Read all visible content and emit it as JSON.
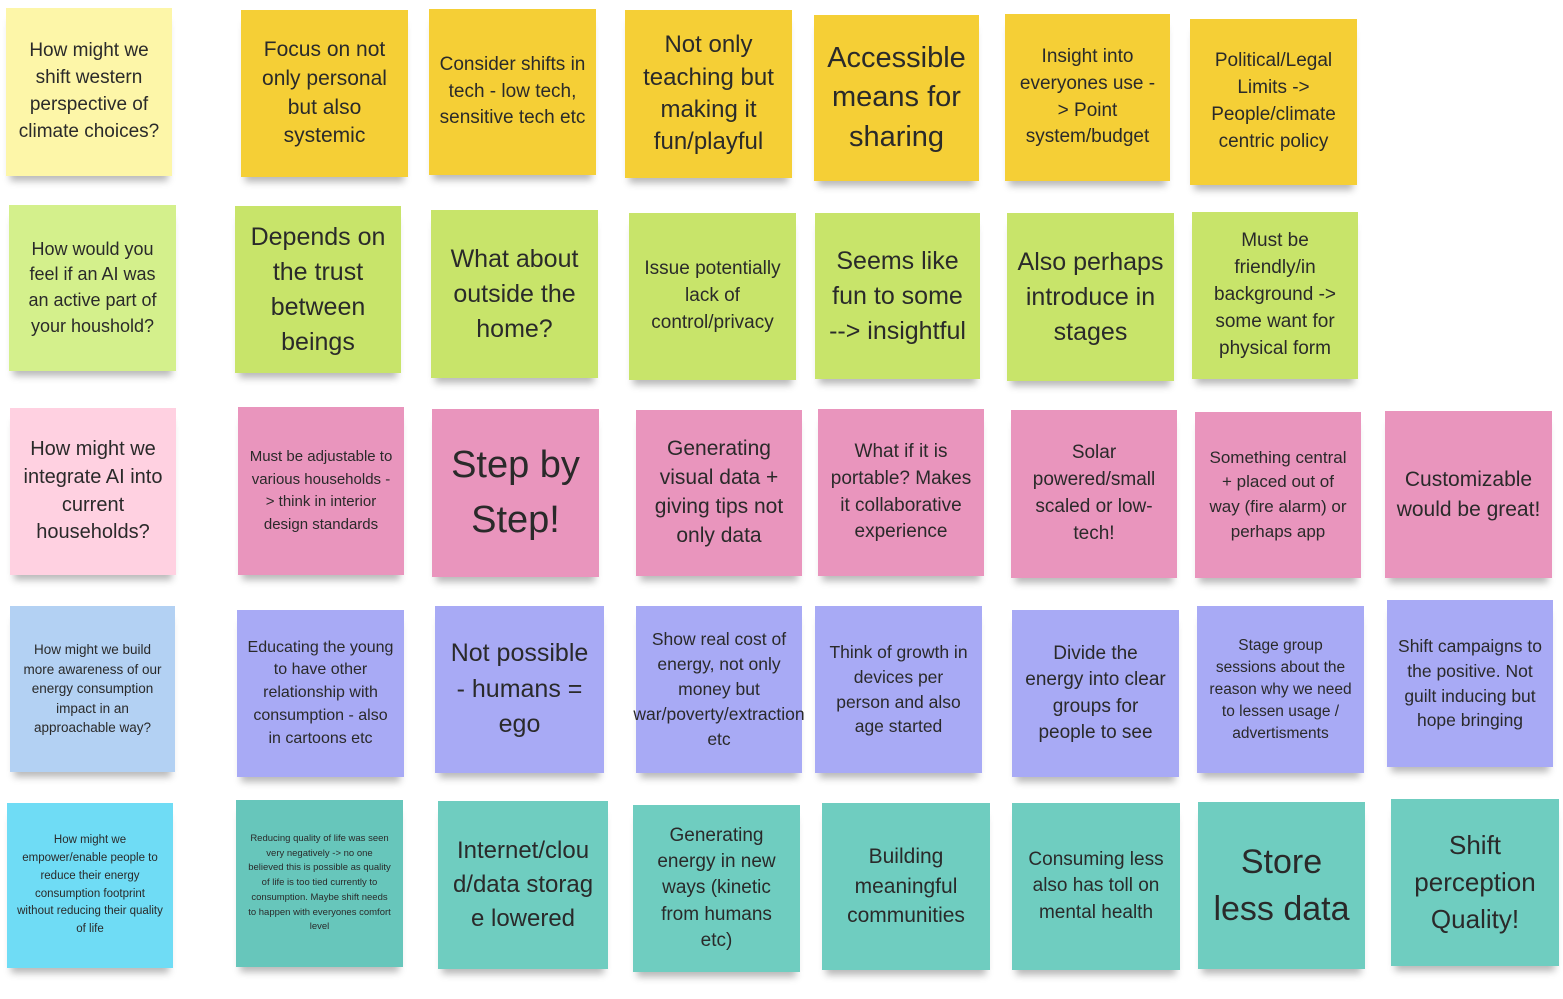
{
  "board": {
    "colors": {
      "pale_yellow": "#fdf6a8",
      "yellow": "#f5cf36",
      "lime": "#c8e46a",
      "pale_lime": "#d4f08c",
      "pink": "#e995bd",
      "pale_pink": "#ffd1e1",
      "violet": "#a8aaf5",
      "pale_blue": "#b3d1f3",
      "teal": "#6fcdc0",
      "cyan": "#6fdcf5",
      "dark_teal": "#67c6bb"
    },
    "rows": [
      {
        "notes": [
          {
            "text": "How might we shift western perspective of climate choices?"
          },
          {
            "text": "Focus on not only personal but also systemic"
          },
          {
            "text": "Consider shifts in tech - low tech, sensitive tech etc"
          },
          {
            "text": "Not only teaching but making it fun/playful"
          },
          {
            "text": "Accessible means for sharing"
          },
          {
            "text": "Insight into everyones use -> Point system/budget"
          },
          {
            "text": "Political/Legal Limits -> People/climate centric policy"
          }
        ]
      },
      {
        "notes": [
          {
            "text": "How would you feel if an AI was an active part of your houshold?"
          },
          {
            "text": "Depends on the trust between beings"
          },
          {
            "text": "What about outside the home?"
          },
          {
            "text": "Issue potentially lack of control/privacy"
          },
          {
            "text": "Seems like fun to some --> insightful"
          },
          {
            "text": "Also perhaps introduce in stages"
          },
          {
            "text": "Must be friendly/in background -> some want for physical form"
          }
        ]
      },
      {
        "notes": [
          {
            "text": "How might we integrate AI into current households?"
          },
          {
            "text": "Must be adjustable to various households -> think in interior design standards"
          },
          {
            "text": "Step by Step!"
          },
          {
            "text": "Generating visual data + giving tips not only data"
          },
          {
            "text": "What if it is portable? Makes it collaborative experience"
          },
          {
            "text": "Solar powered/small scaled or low-tech!"
          },
          {
            "text": "Something central + placed out of way (fire alarm) or perhaps app"
          },
          {
            "text": "Customizable would be great!"
          }
        ]
      },
      {
        "notes": [
          {
            "text": "How might we build more awareness of our energy consumption impact in an approachable way?"
          },
          {
            "text": "Educating the young to have other relationship with consumption - also in cartoons etc"
          },
          {
            "text": "Not possible - humans = ego"
          },
          {
            "text": "Show real cost of energy, not only money but war/poverty/extraction etc"
          },
          {
            "text": "Think of growth in devices per person and also age started"
          },
          {
            "text": "Divide the energy into clear groups for people to see"
          },
          {
            "text": "Stage group sessions about the reason why we need to lessen usage / advertisments"
          },
          {
            "text": "Shift campaigns to the positive. Not guilt inducing but hope bringing"
          }
        ]
      },
      {
        "notes": [
          {
            "text": "How might we empower/enable people to reduce their energy consumption footprint without reducing their quality of life"
          },
          {
            "text": "Reducing quality of life was seen very negatively -> no one believed this is possible as quality of life is too tied currently to consumption. Maybe shift needs to happen with everyones comfort level"
          },
          {
            "text": "Internet/cloud/data storage lowered"
          },
          {
            "text": "Generating energy in new ways (kinetic from humans etc)"
          },
          {
            "text": "Building meaningful communities"
          },
          {
            "text": "Consuming less also has toll on mental health"
          },
          {
            "text": "Store less data"
          },
          {
            "text": "Shift perception Quality!"
          }
        ]
      }
    ]
  }
}
